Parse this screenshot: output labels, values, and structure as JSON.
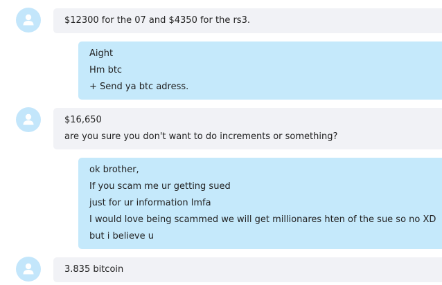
{
  "conversation": {
    "messages": [
      {
        "direction": "incoming",
        "avatar_icon": "default-user-avatar-icon",
        "lines": [
          "$12300 for the 07 and $4350 for the rs3."
        ]
      },
      {
        "direction": "outgoing",
        "lines": [
          "Aight",
          "Hm btc",
          "+ Send ya btc adress."
        ]
      },
      {
        "direction": "incoming",
        "avatar_icon": "default-user-avatar-icon",
        "lines": [
          "$16,650",
          "are you sure you don't want to do increments or something?"
        ]
      },
      {
        "direction": "outgoing",
        "lines": [
          "ok brother,",
          "If you scam me ur getting sued",
          "just for ur information lmfa",
          "I would love being scammed we will get millionares hten of the sue so no XD",
          "but i believe u"
        ]
      },
      {
        "direction": "incoming",
        "avatar_icon": "default-user-avatar-icon",
        "lines": [
          "3.835 bitcoin"
        ]
      }
    ]
  },
  "colors": {
    "incoming_bubble": "#f1f2f6",
    "outgoing_bubble": "#c5e9fb",
    "avatar_background": "#c3e6fb",
    "avatar_glyph": "#ffffff",
    "text": "#222222"
  }
}
